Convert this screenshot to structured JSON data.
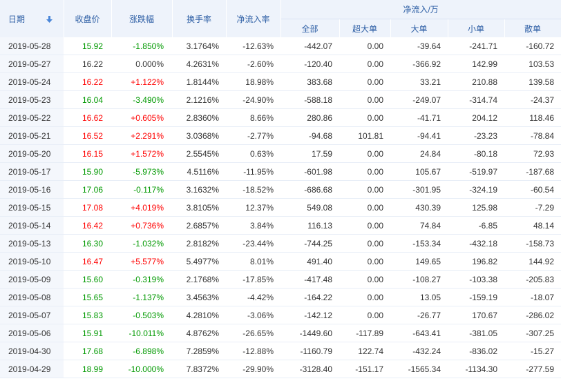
{
  "header": {
    "date": "日期",
    "close": "收盘价",
    "change_pct": "涨跌幅",
    "turnover": "换手率",
    "net_inflow_rate": "净流入率",
    "net_inflow_group": "净流入/万",
    "sub": {
      "total": "全部",
      "super_large": "超大单",
      "large": "大单",
      "small": "小单",
      "retail": "散单"
    },
    "sort_icon": "arrow-down-icon"
  },
  "colors": {
    "up": "#ff0000",
    "down": "#009900",
    "header_text": "#2e5fa5",
    "header_bg": "#eef3fb"
  },
  "rows": [
    {
      "date": "2019-05-28",
      "close": "15.92",
      "change": "-1.850%",
      "turnover": "3.1764%",
      "rate": "-12.63%",
      "total": "-442.07",
      "super": "0.00",
      "large": "-39.64",
      "small": "-241.71",
      "retail": "-160.72",
      "trend": "down"
    },
    {
      "date": "2019-05-27",
      "close": "16.22",
      "change": "0.000%",
      "turnover": "4.2631%",
      "rate": "-2.60%",
      "total": "-120.40",
      "super": "0.00",
      "large": "-366.92",
      "small": "142.99",
      "retail": "103.53",
      "trend": "flat"
    },
    {
      "date": "2019-05-24",
      "close": "16.22",
      "change": "+1.122%",
      "turnover": "1.8144%",
      "rate": "18.98%",
      "total": "383.68",
      "super": "0.00",
      "large": "33.21",
      "small": "210.88",
      "retail": "139.58",
      "trend": "up"
    },
    {
      "date": "2019-05-23",
      "close": "16.04",
      "change": "-3.490%",
      "turnover": "2.1216%",
      "rate": "-24.90%",
      "total": "-588.18",
      "super": "0.00",
      "large": "-249.07",
      "small": "-314.74",
      "retail": "-24.37",
      "trend": "down"
    },
    {
      "date": "2019-05-22",
      "close": "16.62",
      "change": "+0.605%",
      "turnover": "2.8360%",
      "rate": "8.66%",
      "total": "280.86",
      "super": "0.00",
      "large": "-41.71",
      "small": "204.12",
      "retail": "118.46",
      "trend": "up"
    },
    {
      "date": "2019-05-21",
      "close": "16.52",
      "change": "+2.291%",
      "turnover": "3.0368%",
      "rate": "-2.77%",
      "total": "-94.68",
      "super": "101.81",
      "large": "-94.41",
      "small": "-23.23",
      "retail": "-78.84",
      "trend": "up"
    },
    {
      "date": "2019-05-20",
      "close": "16.15",
      "change": "+1.572%",
      "turnover": "2.5545%",
      "rate": "0.63%",
      "total": "17.59",
      "super": "0.00",
      "large": "24.84",
      "small": "-80.18",
      "retail": "72.93",
      "trend": "up"
    },
    {
      "date": "2019-05-17",
      "close": "15.90",
      "change": "-5.973%",
      "turnover": "4.5116%",
      "rate": "-11.95%",
      "total": "-601.98",
      "super": "0.00",
      "large": "105.67",
      "small": "-519.97",
      "retail": "-187.68",
      "trend": "down"
    },
    {
      "date": "2019-05-16",
      "close": "17.06",
      "change": "-0.117%",
      "turnover": "3.1632%",
      "rate": "-18.52%",
      "total": "-686.68",
      "super": "0.00",
      "large": "-301.95",
      "small": "-324.19",
      "retail": "-60.54",
      "trend": "down"
    },
    {
      "date": "2019-05-15",
      "close": "17.08",
      "change": "+4.019%",
      "turnover": "3.8105%",
      "rate": "12.37%",
      "total": "549.08",
      "super": "0.00",
      "large": "430.39",
      "small": "125.98",
      "retail": "-7.29",
      "trend": "up"
    },
    {
      "date": "2019-05-14",
      "close": "16.42",
      "change": "+0.736%",
      "turnover": "2.6857%",
      "rate": "3.84%",
      "total": "116.13",
      "super": "0.00",
      "large": "74.84",
      "small": "-6.85",
      "retail": "48.14",
      "trend": "up"
    },
    {
      "date": "2019-05-13",
      "close": "16.30",
      "change": "-1.032%",
      "turnover": "2.8182%",
      "rate": "-23.44%",
      "total": "-744.25",
      "super": "0.00",
      "large": "-153.34",
      "small": "-432.18",
      "retail": "-158.73",
      "trend": "down"
    },
    {
      "date": "2019-05-10",
      "close": "16.47",
      "change": "+5.577%",
      "turnover": "5.4977%",
      "rate": "8.01%",
      "total": "491.40",
      "super": "0.00",
      "large": "149.65",
      "small": "196.82",
      "retail": "144.92",
      "trend": "up"
    },
    {
      "date": "2019-05-09",
      "close": "15.60",
      "change": "-0.319%",
      "turnover": "2.1768%",
      "rate": "-17.85%",
      "total": "-417.48",
      "super": "0.00",
      "large": "-108.27",
      "small": "-103.38",
      "retail": "-205.83",
      "trend": "down"
    },
    {
      "date": "2019-05-08",
      "close": "15.65",
      "change": "-1.137%",
      "turnover": "3.4563%",
      "rate": "-4.42%",
      "total": "-164.22",
      "super": "0.00",
      "large": "13.05",
      "small": "-159.19",
      "retail": "-18.07",
      "trend": "down"
    },
    {
      "date": "2019-05-07",
      "close": "15.83",
      "change": "-0.503%",
      "turnover": "4.2810%",
      "rate": "-3.06%",
      "total": "-142.12",
      "super": "0.00",
      "large": "-26.77",
      "small": "170.67",
      "retail": "-286.02",
      "trend": "down"
    },
    {
      "date": "2019-05-06",
      "close": "15.91",
      "change": "-10.011%",
      "turnover": "4.8762%",
      "rate": "-26.65%",
      "total": "-1449.60",
      "super": "-117.89",
      "large": "-643.41",
      "small": "-381.05",
      "retail": "-307.25",
      "trend": "down"
    },
    {
      "date": "2019-04-30",
      "close": "17.68",
      "change": "-6.898%",
      "turnover": "7.2859%",
      "rate": "-12.88%",
      "total": "-1160.79",
      "super": "122.74",
      "large": "-432.24",
      "small": "-836.02",
      "retail": "-15.27",
      "trend": "down"
    },
    {
      "date": "2019-04-29",
      "close": "18.99",
      "change": "-10.000%",
      "turnover": "7.8372%",
      "rate": "-29.90%",
      "total": "-3128.40",
      "super": "-151.17",
      "large": "-1565.34",
      "small": "-1134.30",
      "retail": "-277.59",
      "trend": "down"
    }
  ]
}
